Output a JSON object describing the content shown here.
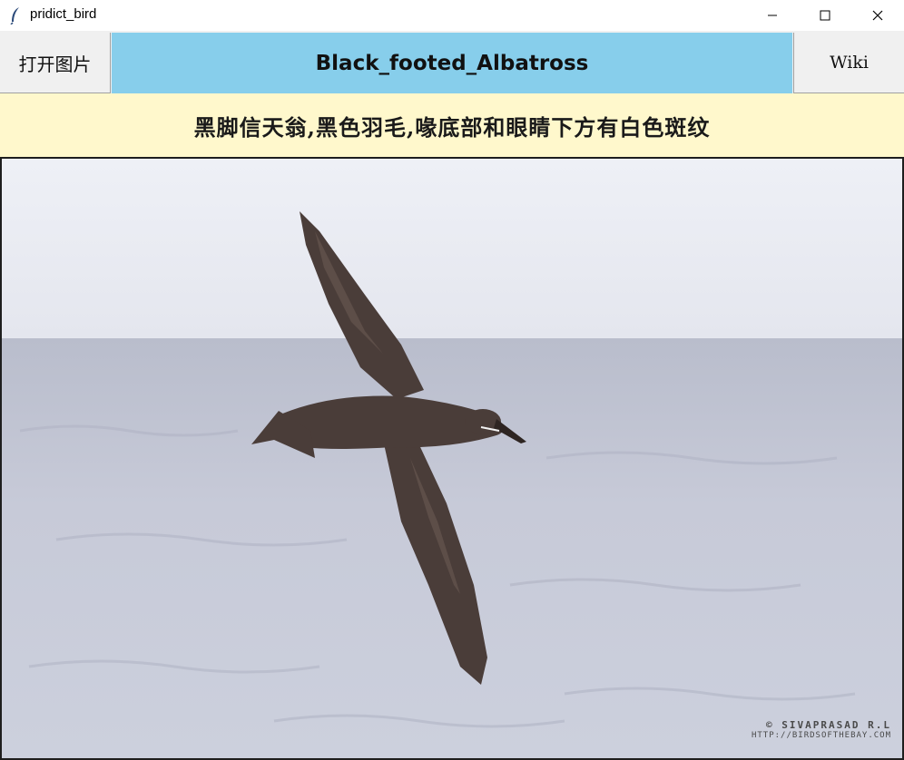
{
  "window": {
    "title": "pridict_bird",
    "icons": [
      "feather-app-icon",
      "minimize-icon",
      "maximize-icon",
      "close-icon"
    ]
  },
  "toolbar": {
    "open_label": "打开图片",
    "species": "Black_footed_Albatross",
    "wiki_label": "Wiki",
    "species_bg": "#87ceeb"
  },
  "description": {
    "text": "黑脚信天翁,黑色羽毛,喙底部和眼睛下方有白色斑纹",
    "bg": "#fff8cc"
  },
  "image": {
    "credit_line1": "© SIVAPRASAD R.L",
    "credit_line2": "HTTP://BIRDSOFTHEBAY.COM"
  }
}
